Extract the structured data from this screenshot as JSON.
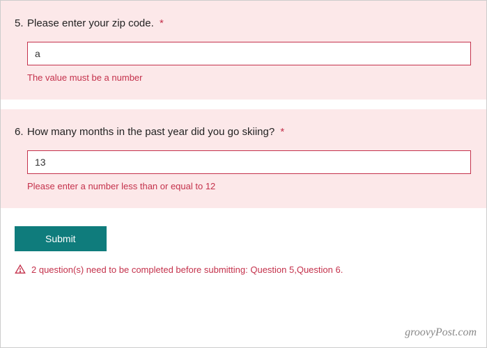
{
  "questions": [
    {
      "number": "5.",
      "text": "Please enter your zip code.",
      "required_mark": "*",
      "value": "a",
      "error": "The value must be a number"
    },
    {
      "number": "6.",
      "text": "How many months in the past year did you go skiing?",
      "required_mark": "*",
      "value": "13",
      "error": "Please enter a number less than or equal to 12"
    }
  ],
  "submit": {
    "label": "Submit"
  },
  "warning": "2 question(s) need to be completed before submitting: Question 5,Question 6.",
  "watermark": "groovyPost.com"
}
